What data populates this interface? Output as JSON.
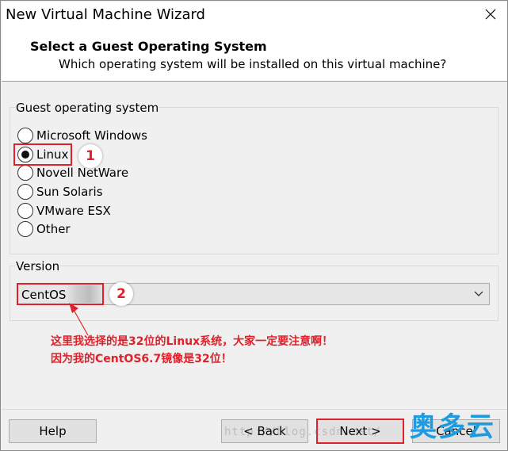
{
  "window": {
    "title": "New Virtual Machine Wizard"
  },
  "header": {
    "title": "Select a Guest Operating System",
    "subtitle": "Which operating system will be installed on this virtual machine?"
  },
  "guest_os": {
    "group_label": "Guest operating system",
    "options": [
      {
        "label": "Microsoft Windows",
        "selected": false
      },
      {
        "label": "Linux",
        "selected": true
      },
      {
        "label": "Novell NetWare",
        "selected": false
      },
      {
        "label": "Sun Solaris",
        "selected": false
      },
      {
        "label": "VMware ESX",
        "selected": false
      },
      {
        "label": "Other",
        "selected": false
      }
    ]
  },
  "version": {
    "group_label": "Version",
    "selected_value": "CentOS"
  },
  "annotations": {
    "marker_1": "1",
    "marker_2": "2",
    "note_line_1": "这里我选择的是32位的Linux系统，大家一定要注意啊！",
    "note_line_2": "因为我的CentOS6.7镜像是32位！",
    "color": "#e0212b"
  },
  "buttons": {
    "help": "Help",
    "back": "< Back",
    "next": "Next >",
    "cancel": "Cancel"
  },
  "watermark": {
    "text": "http://blog.csdn.net/"
  },
  "logo": {
    "text": "奥多云",
    "color": "#1e9be0"
  }
}
